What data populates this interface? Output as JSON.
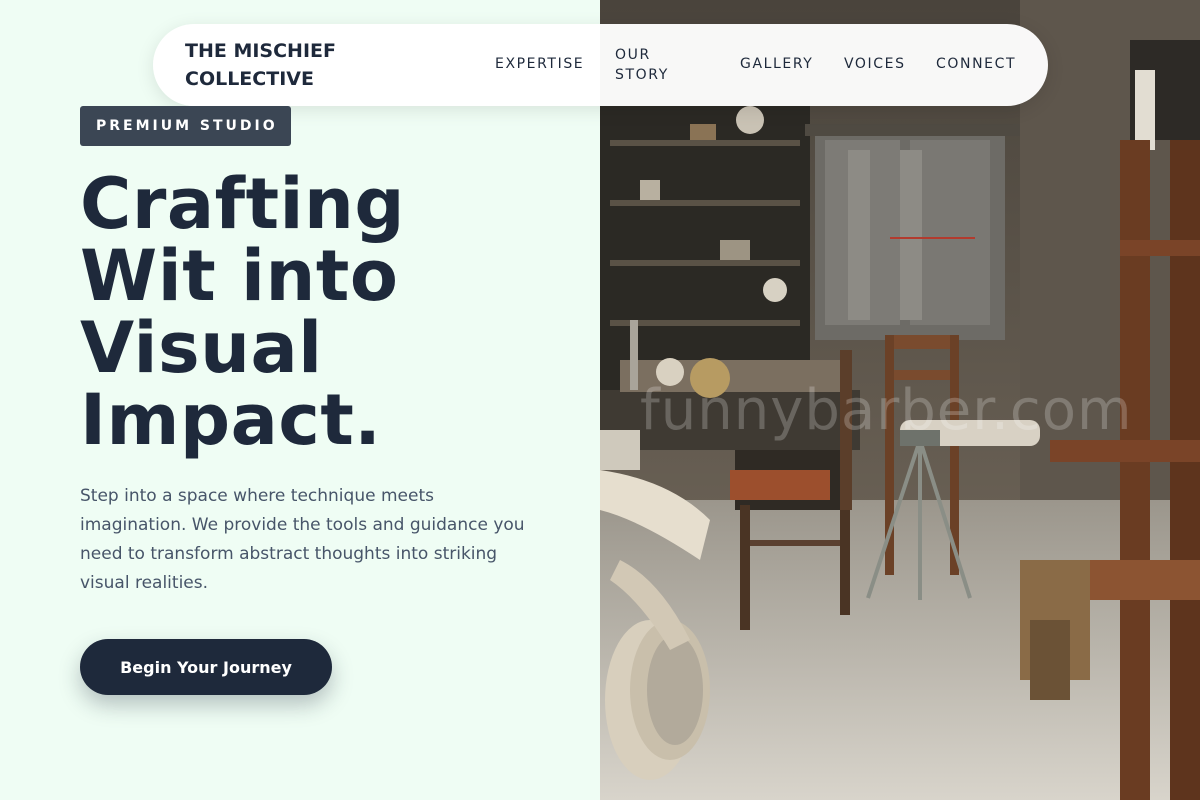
{
  "nav": {
    "brand": "THE MISCHIEF COLLECTIVE",
    "links": [
      "EXPERTISE",
      "OUR STORY",
      "GALLERY",
      "VOICES",
      "CONNECT"
    ]
  },
  "hero": {
    "badge": "PREMIUM STUDIO",
    "headline_lines": [
      "Crafting",
      "Wit into",
      "Visual",
      "Impact."
    ],
    "intro": "Step into a space where technique meets imagination. We provide the tools and guidance you need to transform abstract thoughts into striking visual realities.",
    "cta_label": "Begin Your Journey"
  },
  "photo": {
    "subject": "cluttered artist workshop with wooden chairs, easel and shelves",
    "watermark": "funnybarber.com"
  },
  "colors": {
    "background": "#effdf4",
    "primary": "#1e293b",
    "badge": "#3b4654",
    "body_text": "#475569",
    "nav_bg": "#ffffff"
  }
}
